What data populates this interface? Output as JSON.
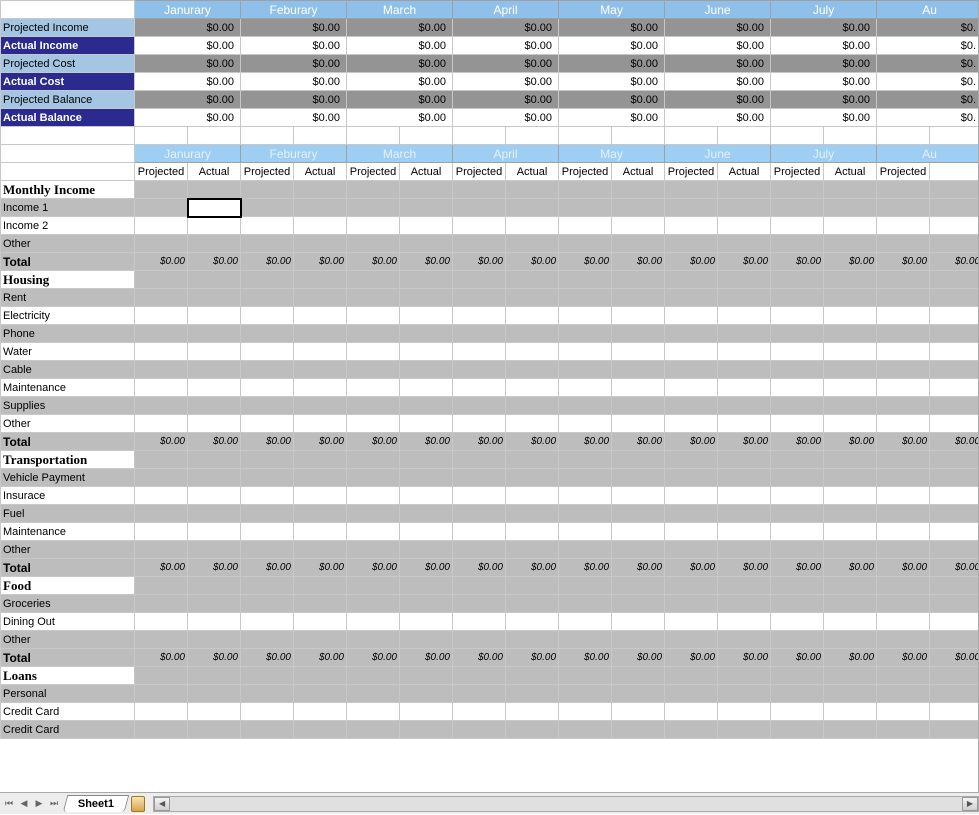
{
  "months": [
    "Janurary",
    "Feburary",
    "March",
    "April",
    "May",
    "June",
    "July",
    "Aug"
  ],
  "partial_month_cut": "Au",
  "summary_rows": [
    {
      "label": "Projected Income",
      "style": "lightblue",
      "bg": "gray",
      "zero": true
    },
    {
      "label": "Actual Income",
      "style": "darkblue",
      "bg": "white",
      "zero": true
    },
    {
      "label": "Projected Cost",
      "style": "lightblue",
      "bg": "gray",
      "zero": true
    },
    {
      "label": "Actual Cost",
      "style": "darkblue",
      "bg": "white",
      "zero": true
    },
    {
      "label": "Projected Balance",
      "style": "lightblue",
      "bg": "gray",
      "zero": true
    },
    {
      "label": "Actual Balance",
      "style": "darkblue",
      "bg": "white",
      "zero": true
    }
  ],
  "subheader": {
    "projected": "Projected",
    "actual": "Actual"
  },
  "zero_money": "$0.00",
  "partial_zero": "$0.",
  "sections": [
    {
      "title": "Monthly Income",
      "rows": [
        "Income 1",
        "Income 2",
        "Other"
      ],
      "total": true,
      "start_alt": "gray"
    },
    {
      "title": "Housing",
      "rows": [
        "Rent",
        "Electricity",
        "Phone",
        "Water",
        "Cable",
        "Maintenance",
        "Supplies",
        "Other"
      ],
      "total": true,
      "start_alt": "gray"
    },
    {
      "title": "Transportation",
      "rows": [
        "Vehicle Payment",
        "Insurace",
        "Fuel",
        "Maintenance",
        "Other"
      ],
      "total": true,
      "start_alt": "gray"
    },
    {
      "title": "Food",
      "rows": [
        "Groceries",
        "Dining Out",
        "Other"
      ],
      "total": true,
      "start_alt": "gray"
    },
    {
      "title": "Loans",
      "rows": [
        "Personal",
        "Credit Card",
        "Credit Card"
      ],
      "total": false,
      "start_alt": "gray"
    }
  ],
  "total_label": "Total",
  "selected_cell": {
    "section": 0,
    "row": 0,
    "col": 1
  },
  "tab": {
    "name": "Sheet1"
  }
}
